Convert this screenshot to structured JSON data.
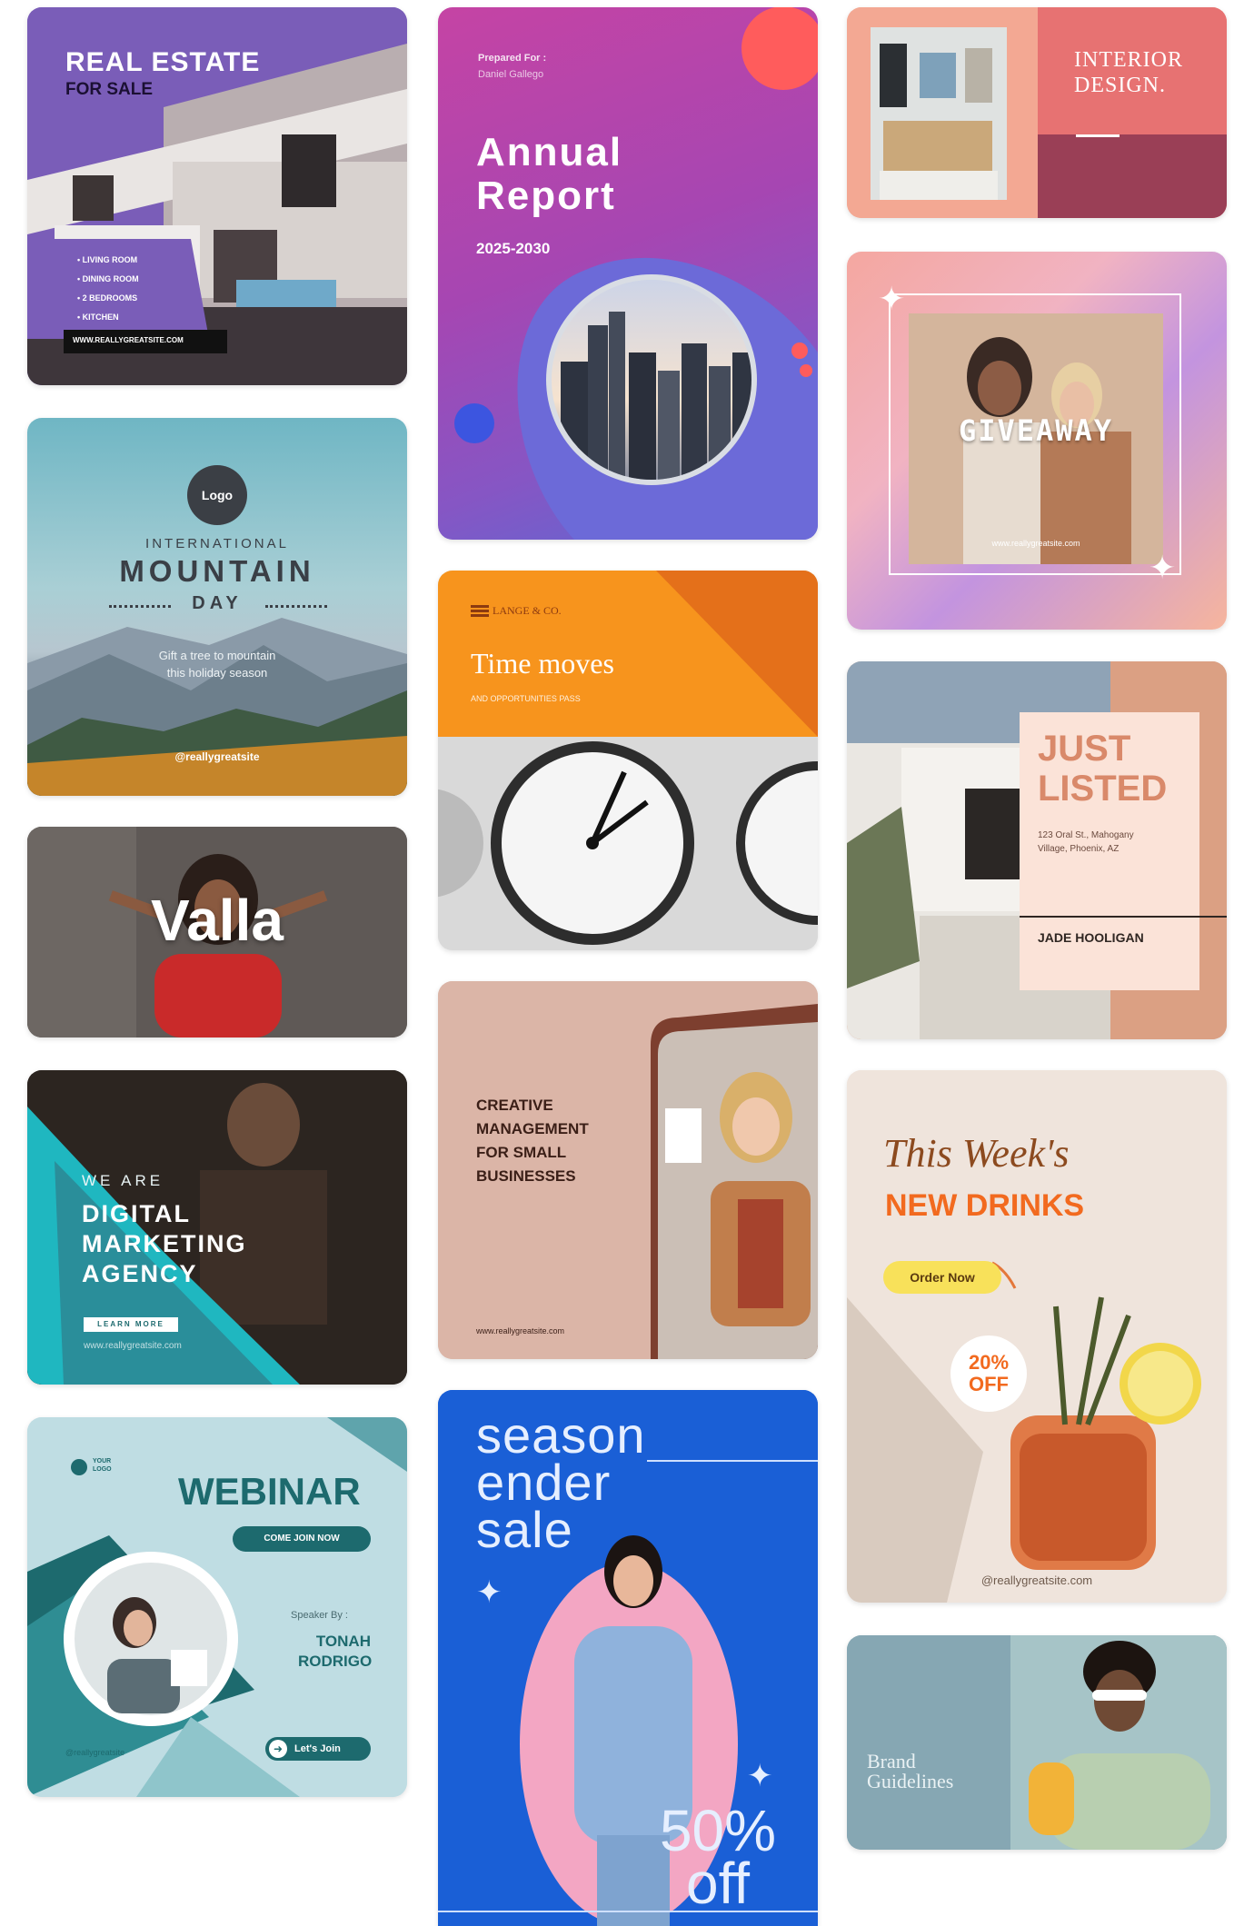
{
  "cards": {
    "realestate": {
      "title": "REAL ESTATE",
      "subtitle": "FOR SALE",
      "features": [
        "• LIVING ROOM",
        "• DINING ROOM",
        "• 2 BEDROOMS",
        "• KITCHEN"
      ],
      "website": "WWW.REALLYGREATSITE.COM"
    },
    "annual": {
      "prepared_label": "Prepared For :",
      "prepared_name": "Daniel Gallego",
      "title_line1": "Annual",
      "title_line2": "Report",
      "years": "2025-2030"
    },
    "interior": {
      "title_line1": "INTERIOR",
      "title_line2": "DESIGN."
    },
    "mountain": {
      "logo": "Logo",
      "line1": "INTERNATIONAL",
      "line2": "MOUNTAIN",
      "line3": "DAY",
      "tagline1": "Gift a tree to mountain",
      "tagline2": "this holiday season",
      "handle": "@reallygreatsite"
    },
    "giveaway": {
      "title": "GIVEAWAY",
      "site": "www.reallygreatsite.com"
    },
    "time": {
      "brand": "LANGE & CO.",
      "title": "Time moves",
      "subtitle": "AND OPPORTUNITIES PASS"
    },
    "valla": {
      "title": "Valla"
    },
    "listed": {
      "title_line1": "JUST",
      "title_line2": "LISTED",
      "address1": "123 Oral St., Mahogany",
      "address2": "Village, Phoenix, AZ",
      "agent": "JADE HOOLIGAN"
    },
    "creative": {
      "line1": "CREATIVE",
      "line2": "MANAGEMENT",
      "line3": "FOR SMALL",
      "line4": "BUSINESSES",
      "site": "www.reallygreatsite.com"
    },
    "digital": {
      "eyebrow": "WE ARE",
      "line1": "DIGITAL",
      "line2": "MARKETING",
      "line3": "AGENCY",
      "button": "LEARN MORE",
      "site": "www.reallygreatsite.com"
    },
    "drinks": {
      "script": "This Week's",
      "title": "NEW DRINKS",
      "button": "Order Now",
      "badge_line1": "20%",
      "badge_line2": "OFF",
      "handle": "@reallygreatsite.com"
    },
    "webinar": {
      "logo_line1": "YOUR",
      "logo_line2": "LOGO",
      "title": "WEBINAR",
      "join_button": "COME JOIN NOW",
      "speaker_label": "Speaker By :",
      "speaker_first": "TONAH",
      "speaker_last": "RODRIGO",
      "handle": "@reallygreatsite",
      "cta": "Let's Join"
    },
    "season": {
      "line1": "season",
      "line2": "ender",
      "line3": "sale",
      "discount_line1": "50%",
      "discount_line2": "off"
    },
    "brand": {
      "line1": "Brand",
      "line2": "Guidelines"
    }
  },
  "colors": {
    "realestate_bg": "#7a5db8",
    "annual_accent": "#ff5c5c",
    "interior_title": "#ffffff",
    "time_orange": "#f7941d",
    "listed_text": "#d9896a",
    "digital_teal": "#1fb7c0",
    "drinks_orange": "#f26a1f",
    "drinks_button": "#f8e15a",
    "webinar_dark": "#1d6a6e",
    "season_blue": "#1a5fd6",
    "season_pink": "#f3a6c3"
  }
}
